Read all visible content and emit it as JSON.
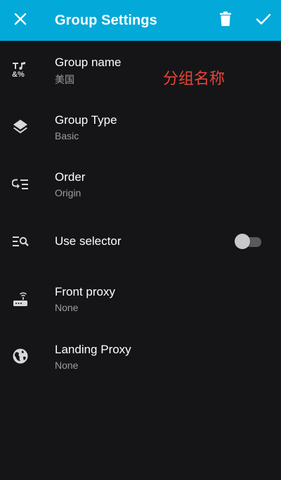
{
  "colors": {
    "primary": "#03a9d8",
    "accent_red": "#e8463c"
  },
  "appbar": {
    "title": "Group Settings",
    "icons": {
      "close": "close-icon",
      "delete": "trash-icon",
      "confirm": "check-icon"
    }
  },
  "settings": [
    {
      "id": "group-name",
      "label": "Group name",
      "value": "美国",
      "icon": "text-format-icon",
      "annotation": "分组名称"
    },
    {
      "id": "group-type",
      "label": "Group Type",
      "value": "Basic",
      "icon": "layers-icon"
    },
    {
      "id": "order",
      "label": "Order",
      "value": "Origin",
      "icon": "sort-order-icon"
    },
    {
      "id": "use-selector",
      "label": "Use selector",
      "icon": "list-search-icon",
      "toggle_on": false
    },
    {
      "id": "front-proxy",
      "label": "Front proxy",
      "value": "None",
      "icon": "router-icon"
    },
    {
      "id": "landing-proxy",
      "label": "Landing Proxy",
      "value": "None",
      "icon": "globe-icon"
    }
  ]
}
